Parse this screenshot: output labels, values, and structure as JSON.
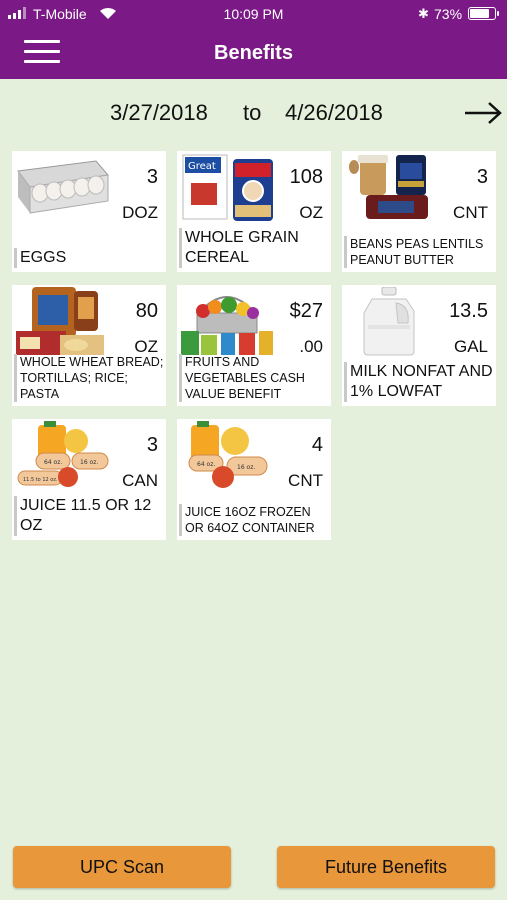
{
  "status_bar": {
    "carrier": "T-Mobile",
    "time": "10:09 PM",
    "battery": "73%",
    "battery_level": 0.73
  },
  "header": {
    "title": "Benefits",
    "menu_icon": "hamburger-menu-icon"
  },
  "period": {
    "start": "3/27/2018",
    "separator": "to",
    "end": "4/26/2018",
    "next_icon": "right-arrow-icon"
  },
  "benefits": [
    {
      "qty": "3",
      "unit": "DOZ",
      "name": "EGGS",
      "icon": "eggs-carton-image"
    },
    {
      "qty": "108",
      "unit": "OZ",
      "name": "WHOLE GRAIN CEREAL",
      "icon": "cereal-boxes-image"
    },
    {
      "qty": "3",
      "unit": "CNT",
      "name": "BEANS PEAS LENTILS PEANUT BUTTER",
      "icon": "beans-peanut-butter-image"
    },
    {
      "qty": "80",
      "unit": "OZ",
      "name": "WHOLE WHEAT BREAD; TORTILLAS; RICE; PASTA",
      "icon": "bread-grains-image"
    },
    {
      "qty": "$27",
      "unit": ".00",
      "name": "FRUITS AND VEGETABLES CASH VALUE BENEFIT",
      "icon": "fruit-vegetable-basket-image"
    },
    {
      "qty": "13.5",
      "unit": "GAL",
      "name": "MILK NONFAT AND 1% LOWFAT",
      "icon": "milk-jug-image"
    },
    {
      "qty": "3",
      "unit": "CAN",
      "name": "JUICE 11.5 OR 12 OZ",
      "icon": "juice-cans-image",
      "labels": [
        "64 oz.",
        "16 oz.",
        "11.5 to 12 oz."
      ]
    },
    {
      "qty": "4",
      "unit": "CNT",
      "name": "JUICE 16OZ FROZEN OR 64OZ CONTAINER",
      "icon": "juice-containers-image",
      "labels": [
        "64 oz.",
        "16 oz."
      ]
    }
  ],
  "footer": {
    "upc_label": "UPC Scan",
    "future_label": "Future Benefits"
  },
  "colors": {
    "header": "#7b1a86",
    "background": "#e4f0db",
    "button": "#e8973a",
    "card": "#ffffff"
  }
}
